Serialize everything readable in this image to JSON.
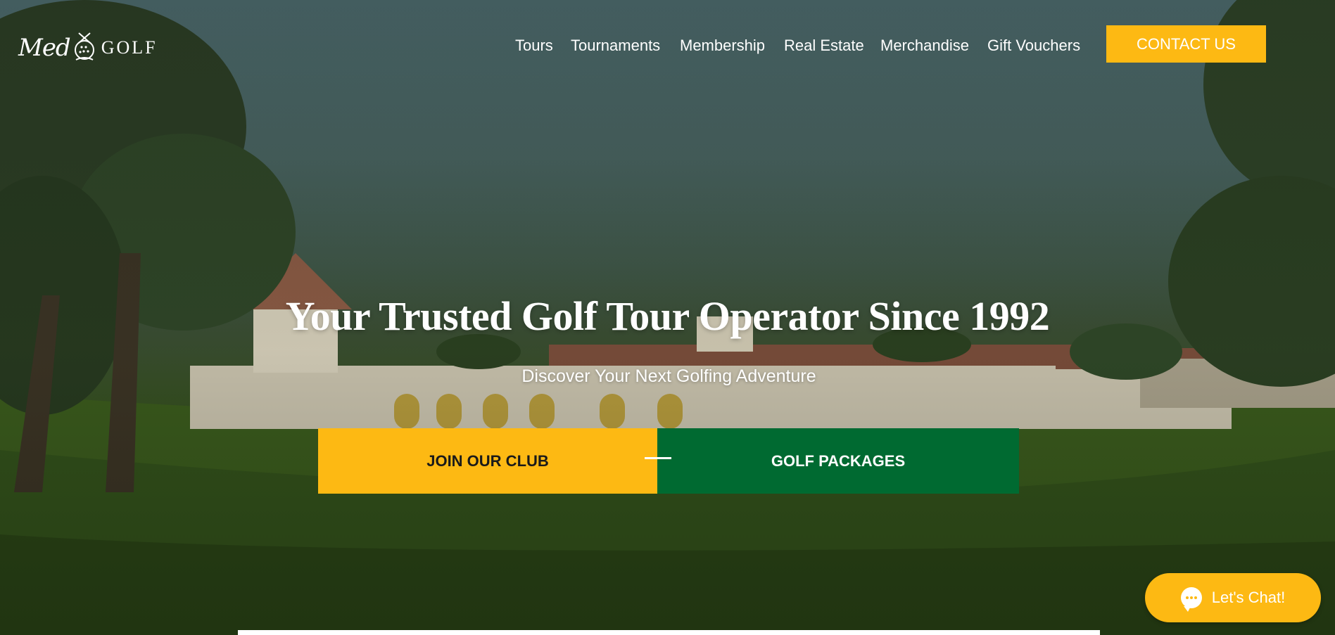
{
  "brand": {
    "logo_script": "Med",
    "logo_word": "GOLF"
  },
  "nav": {
    "items": [
      {
        "label": "Tours"
      },
      {
        "label": "Tournaments"
      },
      {
        "label": "Membership"
      },
      {
        "label": "Real Estate"
      },
      {
        "label": "Merchandise"
      },
      {
        "label": "Gift Vouchers"
      }
    ],
    "contact_label": "CONTACT US"
  },
  "hero": {
    "title": "Your Trusted Golf Tour Operator Since 1992",
    "subtitle": "Discover Your Next Golfing Adventure",
    "cta_join": "JOIN OUR CLUB",
    "cta_packages": "GOLF PACKAGES"
  },
  "chat": {
    "label": "Let's Chat!"
  },
  "colors": {
    "accent_yellow": "#fdb913",
    "accent_green": "#006a31"
  }
}
